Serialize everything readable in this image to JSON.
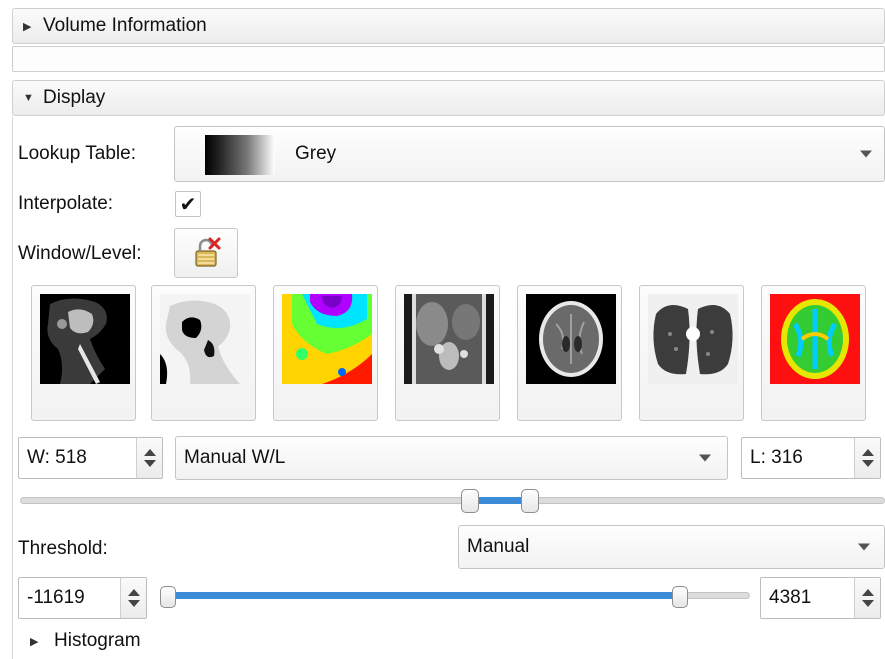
{
  "sections": {
    "volume_information": "Volume Information",
    "display": "Display",
    "histogram": "Histogram"
  },
  "lookup_table": {
    "label": "Lookup Table:",
    "value": "Grey"
  },
  "interpolate": {
    "label": "Interpolate:",
    "checked": true,
    "check_glyph": "✔"
  },
  "window_level": {
    "label": "Window/Level:",
    "lock_icon": "lock-unlocked-icon",
    "presets": [
      {
        "name": "ct-bone-preset"
      },
      {
        "name": "ct-air-preset"
      },
      {
        "name": "pet-rainbow-preset"
      },
      {
        "name": "ct-abdomen-preset"
      },
      {
        "name": "ct-brain-preset"
      },
      {
        "name": "ct-lung-preset"
      },
      {
        "name": "dti-color-preset"
      }
    ],
    "width": "W: 518",
    "mode": "Manual W/L",
    "level": "L: 316",
    "slider_range": [
      0.52,
      0.59
    ]
  },
  "threshold": {
    "label": "Threshold:",
    "mode": "Manual",
    "min": "-11619",
    "max": "4381",
    "slider_range": [
      0.0,
      0.88
    ]
  },
  "colors": {
    "accent": "#3a8cd6"
  }
}
